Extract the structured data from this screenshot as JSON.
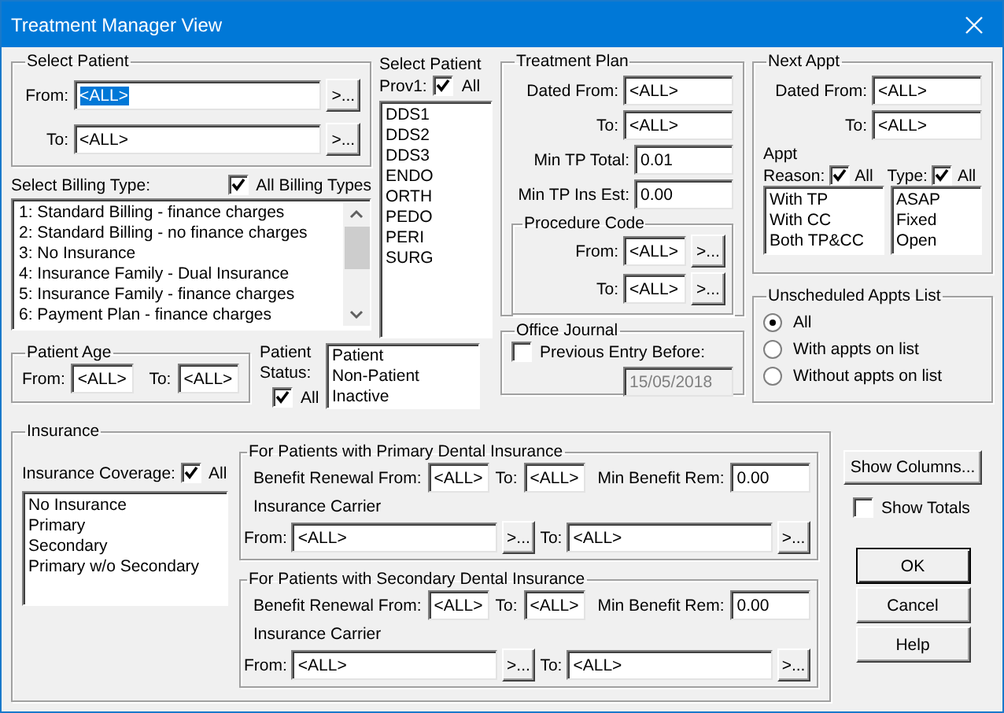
{
  "window": {
    "title": "Treatment Manager View"
  },
  "select_patient": {
    "title": "Select Patient",
    "fields": [
      {
        "label": "From:",
        "value": "<ALL>",
        "highlighted": true,
        "button": ">..."
      },
      {
        "label": "To:",
        "value": "<ALL>",
        "highlighted": false,
        "button": ">..."
      }
    ]
  },
  "billing": {
    "label": "Select Billing Type:",
    "all": {
      "label": "All Billing Types",
      "checked": true
    },
    "items": [
      "1: Standard Billing - finance charges",
      "2: Standard Billing - no finance charges",
      "3: No Insurance",
      "4: Insurance Family - Dual Insurance",
      "5: Insurance Family - finance charges",
      "6: Payment Plan - finance charges"
    ]
  },
  "provider": {
    "title": "Select Patient",
    "label": "Prov1:",
    "all": {
      "label": "All",
      "checked": true
    },
    "items": [
      "DDS1",
      "DDS2",
      "DDS3",
      "ENDO",
      "ORTH",
      "PEDO",
      "PERI",
      "SURG"
    ]
  },
  "patient_age": {
    "title": "Patient Age",
    "from": {
      "label": "From:",
      "value": "<ALL>"
    },
    "to": {
      "label": "To:",
      "value": "<ALL>"
    }
  },
  "patient_status": {
    "label": "Patient Status:",
    "all": {
      "label": "All",
      "checked": true
    },
    "items": [
      "Patient",
      "Non-Patient",
      "Inactive"
    ]
  },
  "treatment_plan": {
    "title": "Treatment Plan",
    "fields": [
      {
        "label": "Dated From:",
        "value": "<ALL>"
      },
      {
        "label": "To:",
        "value": "<ALL>"
      },
      {
        "label": "Min TP Total:",
        "value": "0.01"
      },
      {
        "label": "Min TP Ins Est:",
        "value": "0.00"
      }
    ],
    "procedure_code": {
      "title": "Procedure Code",
      "fields": [
        {
          "label": "From:",
          "value": "<ALL>",
          "button": ">..."
        },
        {
          "label": "To:",
          "value": "<ALL>",
          "button": ">..."
        }
      ]
    }
  },
  "office_journal": {
    "title": "Office Journal",
    "previous_entry": {
      "label": "Previous Entry Before:",
      "checked": false
    },
    "date": {
      "value": "15/05/2018",
      "disabled": true
    }
  },
  "next_appt": {
    "title": "Next Appt",
    "fields": [
      {
        "label": "Dated From:",
        "value": "<ALL>"
      },
      {
        "label": "To:",
        "value": "<ALL>"
      }
    ],
    "reason": {
      "label_line1": "Appt",
      "label": "Reason:",
      "all": {
        "label": "All",
        "checked": true
      },
      "items": [
        "With TP",
        "With CC",
        "Both TP&CC"
      ]
    },
    "type": {
      "label": "Type:",
      "all": {
        "label": "All",
        "checked": true
      },
      "items": [
        "ASAP",
        "Fixed",
        "Open"
      ]
    }
  },
  "unscheduled": {
    "title": "Unscheduled Appts List",
    "options": [
      {
        "label": "All",
        "selected": true
      },
      {
        "label": "With appts on list",
        "selected": false
      },
      {
        "label": "Without appts on list",
        "selected": false
      }
    ]
  },
  "insurance": {
    "title": "Insurance",
    "coverage": {
      "label": "Insurance Coverage:",
      "all": {
        "label": "All",
        "checked": true
      },
      "items": [
        "No Insurance",
        "Primary",
        "Secondary",
        "Primary w/o Secondary"
      ]
    },
    "groups": [
      {
        "title": "For Patients with Primary Dental Insurance",
        "benefit_from": {
          "label": "Benefit Renewal From:",
          "value": "<ALL>"
        },
        "benefit_to": {
          "label": "To:",
          "value": "<ALL>"
        },
        "min_benefit": {
          "label": "Min Benefit Rem:",
          "value": "0.00"
        },
        "carrier_label": "Insurance Carrier",
        "carrier_from": {
          "label": "From:",
          "value": "<ALL>",
          "button": ">..."
        },
        "carrier_to": {
          "label": "To:",
          "value": "<ALL>",
          "button": ">..."
        }
      },
      {
        "title": "For Patients with Secondary Dental Insurance",
        "benefit_from": {
          "label": "Benefit Renewal From:",
          "value": "<ALL>"
        },
        "benefit_to": {
          "label": "To:",
          "value": "<ALL>"
        },
        "min_benefit": {
          "label": "Min Benefit Rem:",
          "value": "0.00"
        },
        "carrier_label": "Insurance Carrier",
        "carrier_from": {
          "label": "From:",
          "value": "<ALL>",
          "button": ">..."
        },
        "carrier_to": {
          "label": "To:",
          "value": "<ALL>",
          "button": ">..."
        }
      }
    ]
  },
  "actions": {
    "show_columns": "Show Columns...",
    "show_totals": {
      "label": "Show Totals",
      "checked": false
    },
    "buttons": [
      {
        "label": "OK",
        "default": true
      },
      {
        "label": "Cancel",
        "default": false
      },
      {
        "label": "Help",
        "default": false
      }
    ]
  }
}
